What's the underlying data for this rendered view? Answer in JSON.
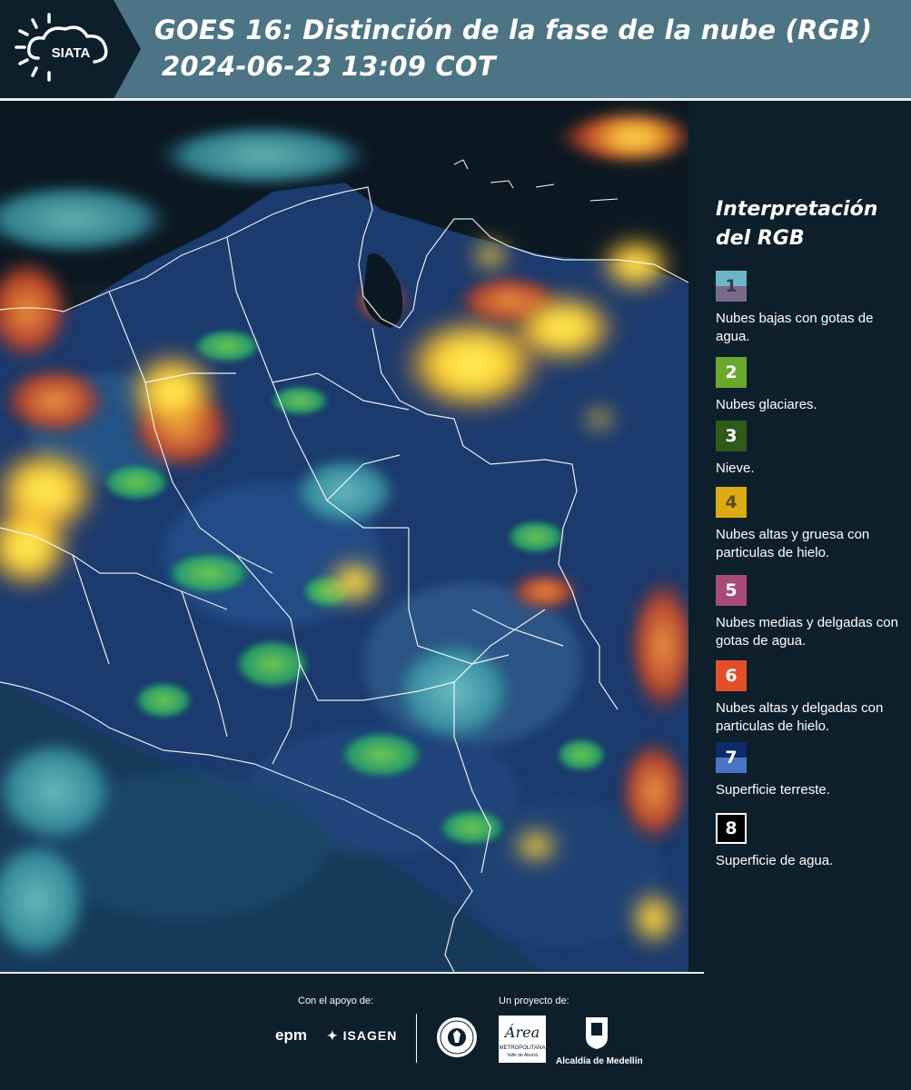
{
  "header": {
    "logo_text": "SIATA",
    "title_line1": "GOES 16: Distinción de la fase de la nube (RGB)",
    "title_line2": "2024-06-23 13:09 COT"
  },
  "map": {
    "icon": "satellite-rgb-image"
  },
  "legend": {
    "title_line1": "Interpretación",
    "title_line2": "del RGB",
    "items": [
      {
        "number": "1",
        "label": "Nubes bajas con gotas de agua.",
        "color_top": "#6ab6c8",
        "color_bottom": "#7a6a8a"
      },
      {
        "number": "2",
        "label": "Nubes glaciares.",
        "color_top": "#6aa82a",
        "color_bottom": "#6aa82a"
      },
      {
        "number": "3",
        "label": "Nieve.",
        "color_top": "#2f5a18",
        "color_bottom": "#2f5a18"
      },
      {
        "number": "4",
        "label": "Nubes altas y gruesa con particulas de hielo.",
        "color_top": "#dcaa14",
        "color_bottom": "#dcaa14"
      },
      {
        "number": "5",
        "label": "Nubes medias y delgadas con gotas de agua.",
        "color_top": "#a84a7a",
        "color_bottom": "#a84a7a"
      },
      {
        "number": "6",
        "label": "Nubes altas y delgadas con particulas de hielo.",
        "color_top": "#e2502a",
        "color_bottom": "#e2502a"
      },
      {
        "number": "7",
        "label": "Superficie terreste.",
        "color_top": "#0f2a6a",
        "color_bottom": "#4a74c8"
      },
      {
        "number": "8",
        "label": "Superficie de agua.",
        "color_top": "#000000",
        "color_bottom": "#000000"
      }
    ]
  },
  "footer": {
    "support_label": "Con el apoyo de:",
    "project_label": "Un proyecto de:",
    "epm": "epm",
    "isagen": "ISAGEN",
    "amva_script": "Área",
    "amva_line1": "METROPOLITANA",
    "amva_line2": "Valle de Aburrá",
    "alcaldia": "Alcaldía de Medellín"
  }
}
